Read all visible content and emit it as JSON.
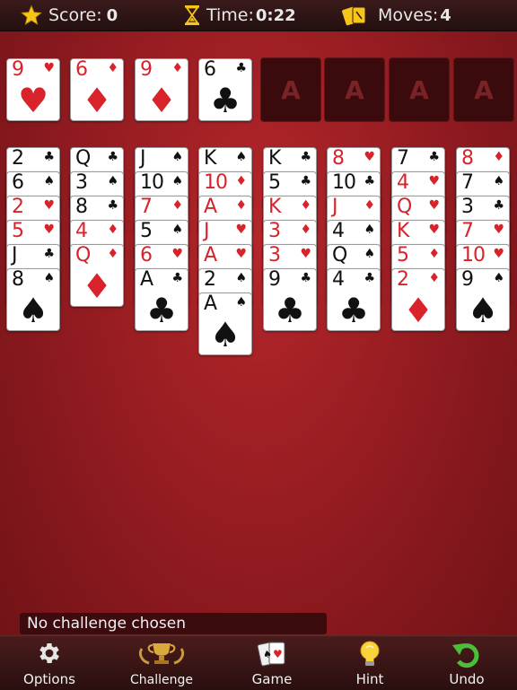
{
  "stats": {
    "score_label": "Score:",
    "score_value": "0",
    "time_label": "Time:",
    "time_value": "0:22",
    "moves_label": "Moves:",
    "moves_value": "4"
  },
  "free_cells": [
    {
      "rank": "9",
      "suit": "♥",
      "color": "red"
    },
    {
      "rank": "6",
      "suit": "♦",
      "color": "red"
    },
    {
      "rank": "9",
      "suit": "♦",
      "color": "red"
    },
    {
      "rank": "6",
      "suit": "♣",
      "color": "black"
    }
  ],
  "foundations": [
    "A",
    "A",
    "A",
    "A"
  ],
  "tableau": [
    [
      {
        "rank": "2",
        "suit": "♣",
        "color": "black"
      },
      {
        "rank": "6",
        "suit": "♠",
        "color": "black"
      },
      {
        "rank": "2",
        "suit": "♥",
        "color": "red"
      },
      {
        "rank": "5",
        "suit": "♥",
        "color": "red"
      },
      {
        "rank": "J",
        "suit": "♣",
        "color": "black"
      },
      {
        "rank": "8",
        "suit": "♠",
        "color": "black"
      }
    ],
    [
      {
        "rank": "Q",
        "suit": "♣",
        "color": "black"
      },
      {
        "rank": "3",
        "suit": "♠",
        "color": "black"
      },
      {
        "rank": "8",
        "suit": "♣",
        "color": "black"
      },
      {
        "rank": "4",
        "suit": "♦",
        "color": "red"
      },
      {
        "rank": "Q",
        "suit": "♦",
        "color": "red"
      }
    ],
    [
      {
        "rank": "J",
        "suit": "♠",
        "color": "black"
      },
      {
        "rank": "10",
        "suit": "♠",
        "color": "black"
      },
      {
        "rank": "7",
        "suit": "♦",
        "color": "red"
      },
      {
        "rank": "5",
        "suit": "♠",
        "color": "black"
      },
      {
        "rank": "6",
        "suit": "♥",
        "color": "red"
      },
      {
        "rank": "A",
        "suit": "♣",
        "color": "black"
      }
    ],
    [
      {
        "rank": "K",
        "suit": "♠",
        "color": "black"
      },
      {
        "rank": "10",
        "suit": "♦",
        "color": "red"
      },
      {
        "rank": "A",
        "suit": "♦",
        "color": "red"
      },
      {
        "rank": "J",
        "suit": "♥",
        "color": "red"
      },
      {
        "rank": "A",
        "suit": "♥",
        "color": "red"
      },
      {
        "rank": "2",
        "suit": "♠",
        "color": "black"
      },
      {
        "rank": "A",
        "suit": "♠",
        "color": "black"
      }
    ],
    [
      {
        "rank": "K",
        "suit": "♣",
        "color": "black"
      },
      {
        "rank": "5",
        "suit": "♣",
        "color": "black"
      },
      {
        "rank": "K",
        "suit": "♦",
        "color": "red"
      },
      {
        "rank": "3",
        "suit": "♦",
        "color": "red"
      },
      {
        "rank": "3",
        "suit": "♥",
        "color": "red"
      },
      {
        "rank": "9",
        "suit": "♣",
        "color": "black"
      }
    ],
    [
      {
        "rank": "8",
        "suit": "♥",
        "color": "red"
      },
      {
        "rank": "10",
        "suit": "♣",
        "color": "black"
      },
      {
        "rank": "J",
        "suit": "♦",
        "color": "red"
      },
      {
        "rank": "4",
        "suit": "♠",
        "color": "black"
      },
      {
        "rank": "Q",
        "suit": "♠",
        "color": "black"
      },
      {
        "rank": "4",
        "suit": "♣",
        "color": "black"
      }
    ],
    [
      {
        "rank": "7",
        "suit": "♣",
        "color": "black"
      },
      {
        "rank": "4",
        "suit": "♥",
        "color": "red"
      },
      {
        "rank": "Q",
        "suit": "♥",
        "color": "red"
      },
      {
        "rank": "K",
        "suit": "♥",
        "color": "red"
      },
      {
        "rank": "5",
        "suit": "♦",
        "color": "red"
      },
      {
        "rank": "2",
        "suit": "♦",
        "color": "red"
      }
    ],
    [
      {
        "rank": "8",
        "suit": "♦",
        "color": "red"
      },
      {
        "rank": "7",
        "suit": "♠",
        "color": "black"
      },
      {
        "rank": "3",
        "suit": "♣",
        "color": "black"
      },
      {
        "rank": "7",
        "suit": "♥",
        "color": "red"
      },
      {
        "rank": "10",
        "suit": "♥",
        "color": "red"
      },
      {
        "rank": "9",
        "suit": "♠",
        "color": "black"
      }
    ]
  ],
  "challenge_text": "No challenge chosen",
  "toolbar": [
    {
      "label": "Options",
      "icon": "gear-icon"
    },
    {
      "label": "Challenge",
      "icon": "trophy-icon"
    },
    {
      "label": "Game",
      "icon": "cards-icon"
    },
    {
      "label": "Hint",
      "icon": "lightbulb-icon"
    },
    {
      "label": "Undo",
      "icon": "undo-arrow-icon"
    }
  ],
  "colors": {
    "felt": "#9e1f24",
    "card_red": "#d8232a",
    "card_black": "#111111",
    "foundation_bg": "#3a0a0c",
    "star": "#f5c518"
  }
}
